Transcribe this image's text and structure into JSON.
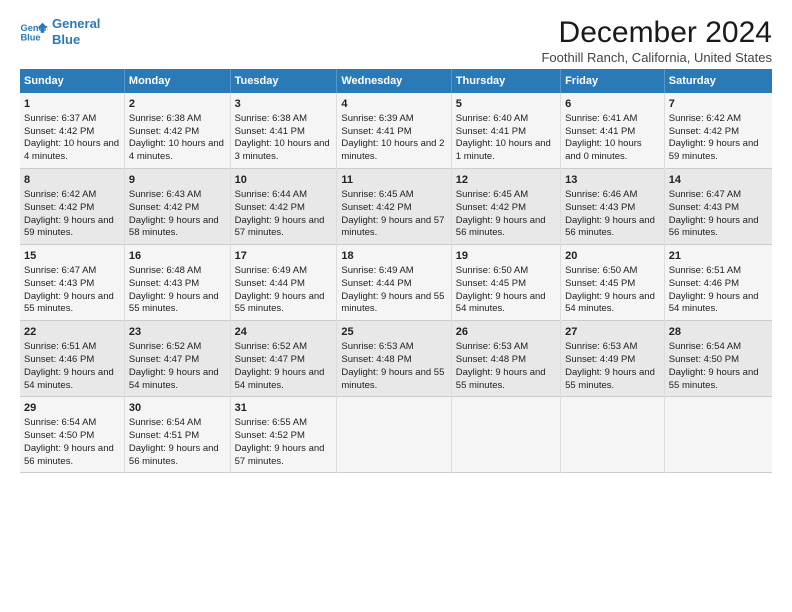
{
  "logo": {
    "line1": "General",
    "line2": "Blue"
  },
  "title": "December 2024",
  "subtitle": "Foothill Ranch, California, United States",
  "days_of_week": [
    "Sunday",
    "Monday",
    "Tuesday",
    "Wednesday",
    "Thursday",
    "Friday",
    "Saturday"
  ],
  "weeks": [
    [
      {
        "day": "1",
        "sunrise": "6:37 AM",
        "sunset": "4:42 PM",
        "daylight": "10 hours and 4 minutes."
      },
      {
        "day": "2",
        "sunrise": "6:38 AM",
        "sunset": "4:42 PM",
        "daylight": "10 hours and 4 minutes."
      },
      {
        "day": "3",
        "sunrise": "6:38 AM",
        "sunset": "4:41 PM",
        "daylight": "10 hours and 3 minutes."
      },
      {
        "day": "4",
        "sunrise": "6:39 AM",
        "sunset": "4:41 PM",
        "daylight": "10 hours and 2 minutes."
      },
      {
        "day": "5",
        "sunrise": "6:40 AM",
        "sunset": "4:41 PM",
        "daylight": "10 hours and 1 minute."
      },
      {
        "day": "6",
        "sunrise": "6:41 AM",
        "sunset": "4:41 PM",
        "daylight": "10 hours and 0 minutes."
      },
      {
        "day": "7",
        "sunrise": "6:42 AM",
        "sunset": "4:42 PM",
        "daylight": "9 hours and 59 minutes."
      }
    ],
    [
      {
        "day": "8",
        "sunrise": "6:42 AM",
        "sunset": "4:42 PM",
        "daylight": "9 hours and 59 minutes."
      },
      {
        "day": "9",
        "sunrise": "6:43 AM",
        "sunset": "4:42 PM",
        "daylight": "9 hours and 58 minutes."
      },
      {
        "day": "10",
        "sunrise": "6:44 AM",
        "sunset": "4:42 PM",
        "daylight": "9 hours and 57 minutes."
      },
      {
        "day": "11",
        "sunrise": "6:45 AM",
        "sunset": "4:42 PM",
        "daylight": "9 hours and 57 minutes."
      },
      {
        "day": "12",
        "sunrise": "6:45 AM",
        "sunset": "4:42 PM",
        "daylight": "9 hours and 56 minutes."
      },
      {
        "day": "13",
        "sunrise": "6:46 AM",
        "sunset": "4:43 PM",
        "daylight": "9 hours and 56 minutes."
      },
      {
        "day": "14",
        "sunrise": "6:47 AM",
        "sunset": "4:43 PM",
        "daylight": "9 hours and 56 minutes."
      }
    ],
    [
      {
        "day": "15",
        "sunrise": "6:47 AM",
        "sunset": "4:43 PM",
        "daylight": "9 hours and 55 minutes."
      },
      {
        "day": "16",
        "sunrise": "6:48 AM",
        "sunset": "4:43 PM",
        "daylight": "9 hours and 55 minutes."
      },
      {
        "day": "17",
        "sunrise": "6:49 AM",
        "sunset": "4:44 PM",
        "daylight": "9 hours and 55 minutes."
      },
      {
        "day": "18",
        "sunrise": "6:49 AM",
        "sunset": "4:44 PM",
        "daylight": "9 hours and 55 minutes."
      },
      {
        "day": "19",
        "sunrise": "6:50 AM",
        "sunset": "4:45 PM",
        "daylight": "9 hours and 54 minutes."
      },
      {
        "day": "20",
        "sunrise": "6:50 AM",
        "sunset": "4:45 PM",
        "daylight": "9 hours and 54 minutes."
      },
      {
        "day": "21",
        "sunrise": "6:51 AM",
        "sunset": "4:46 PM",
        "daylight": "9 hours and 54 minutes."
      }
    ],
    [
      {
        "day": "22",
        "sunrise": "6:51 AM",
        "sunset": "4:46 PM",
        "daylight": "9 hours and 54 minutes."
      },
      {
        "day": "23",
        "sunrise": "6:52 AM",
        "sunset": "4:47 PM",
        "daylight": "9 hours and 54 minutes."
      },
      {
        "day": "24",
        "sunrise": "6:52 AM",
        "sunset": "4:47 PM",
        "daylight": "9 hours and 54 minutes."
      },
      {
        "day": "25",
        "sunrise": "6:53 AM",
        "sunset": "4:48 PM",
        "daylight": "9 hours and 55 minutes."
      },
      {
        "day": "26",
        "sunrise": "6:53 AM",
        "sunset": "4:48 PM",
        "daylight": "9 hours and 55 minutes."
      },
      {
        "day": "27",
        "sunrise": "6:53 AM",
        "sunset": "4:49 PM",
        "daylight": "9 hours and 55 minutes."
      },
      {
        "day": "28",
        "sunrise": "6:54 AM",
        "sunset": "4:50 PM",
        "daylight": "9 hours and 55 minutes."
      }
    ],
    [
      {
        "day": "29",
        "sunrise": "6:54 AM",
        "sunset": "4:50 PM",
        "daylight": "9 hours and 56 minutes."
      },
      {
        "day": "30",
        "sunrise": "6:54 AM",
        "sunset": "4:51 PM",
        "daylight": "9 hours and 56 minutes."
      },
      {
        "day": "31",
        "sunrise": "6:55 AM",
        "sunset": "4:52 PM",
        "daylight": "9 hours and 57 minutes."
      },
      null,
      null,
      null,
      null
    ]
  ]
}
